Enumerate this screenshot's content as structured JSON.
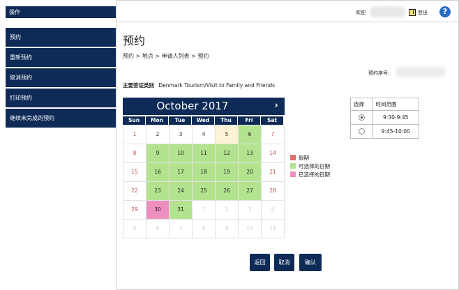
{
  "sidebar": {
    "header": "操作",
    "items": [
      {
        "label": "预约"
      },
      {
        "label": "重新预约"
      },
      {
        "label": "取消预约"
      },
      {
        "label": "打印预约"
      },
      {
        "label": "继续未完成的预约"
      }
    ]
  },
  "topbar": {
    "welcome": "欢迎",
    "logout": "登出",
    "help": "?"
  },
  "page": {
    "title": "预约",
    "breadcrumb": "预约 > 地点 > 申请人列表 > 预约",
    "booking_no_label": "预约序号:",
    "visa_label": "主要签证类别",
    "visa_value": "Denmark Tourism/Visit to Family and Friends"
  },
  "calendar": {
    "month": "October 2017",
    "next": "›",
    "weekdays": [
      "Sun",
      "Mon",
      "Tue",
      "Wed",
      "Thu",
      "Fri",
      "Sat"
    ],
    "days": [
      {
        "d": "1",
        "s": "weekend"
      },
      {
        "d": "2",
        "s": ""
      },
      {
        "d": "3",
        "s": ""
      },
      {
        "d": "4",
        "s": ""
      },
      {
        "d": "5",
        "s": "today"
      },
      {
        "d": "6",
        "s": "avail"
      },
      {
        "d": "7",
        "s": "weekend"
      },
      {
        "d": "8",
        "s": "weekend"
      },
      {
        "d": "9",
        "s": "avail"
      },
      {
        "d": "10",
        "s": "avail"
      },
      {
        "d": "11",
        "s": "avail"
      },
      {
        "d": "12",
        "s": "avail"
      },
      {
        "d": "13",
        "s": "avail"
      },
      {
        "d": "14",
        "s": "weekend"
      },
      {
        "d": "15",
        "s": "weekend"
      },
      {
        "d": "16",
        "s": "avail"
      },
      {
        "d": "17",
        "s": "avail"
      },
      {
        "d": "18",
        "s": "avail"
      },
      {
        "d": "19",
        "s": "avail"
      },
      {
        "d": "20",
        "s": "avail"
      },
      {
        "d": "21",
        "s": "weekend"
      },
      {
        "d": "22",
        "s": "weekend"
      },
      {
        "d": "23",
        "s": "avail"
      },
      {
        "d": "24",
        "s": "avail"
      },
      {
        "d": "25",
        "s": "avail"
      },
      {
        "d": "26",
        "s": "avail"
      },
      {
        "d": "27",
        "s": "avail"
      },
      {
        "d": "28",
        "s": "weekend"
      },
      {
        "d": "29",
        "s": "weekend"
      },
      {
        "d": "30",
        "s": "selected"
      },
      {
        "d": "31",
        "s": "avail"
      },
      {
        "d": "1",
        "s": "other"
      },
      {
        "d": "2",
        "s": "other"
      },
      {
        "d": "3",
        "s": "other"
      },
      {
        "d": "4",
        "s": "other"
      },
      {
        "d": "5",
        "s": "other"
      },
      {
        "d": "6",
        "s": "other"
      },
      {
        "d": "7",
        "s": "other"
      },
      {
        "d": "8",
        "s": "other"
      },
      {
        "d": "9",
        "s": "other"
      },
      {
        "d": "10",
        "s": "other"
      },
      {
        "d": "11",
        "s": "other"
      }
    ]
  },
  "legend": [
    {
      "label": "假期",
      "color": "#e26f6f"
    },
    {
      "label": "可选择的日期",
      "color": "#b3e38f"
    },
    {
      "label": "已选择的日期",
      "color": "#ee8fc0"
    }
  ],
  "timetable": {
    "headers": [
      "选择",
      "时间范围"
    ],
    "rows": [
      {
        "time": "9:30-9:45",
        "checked": true
      },
      {
        "time": "9:45-10:00",
        "checked": false
      }
    ]
  },
  "buttons": {
    "back": "返回",
    "cancel": "取消",
    "confirm": "确认"
  }
}
